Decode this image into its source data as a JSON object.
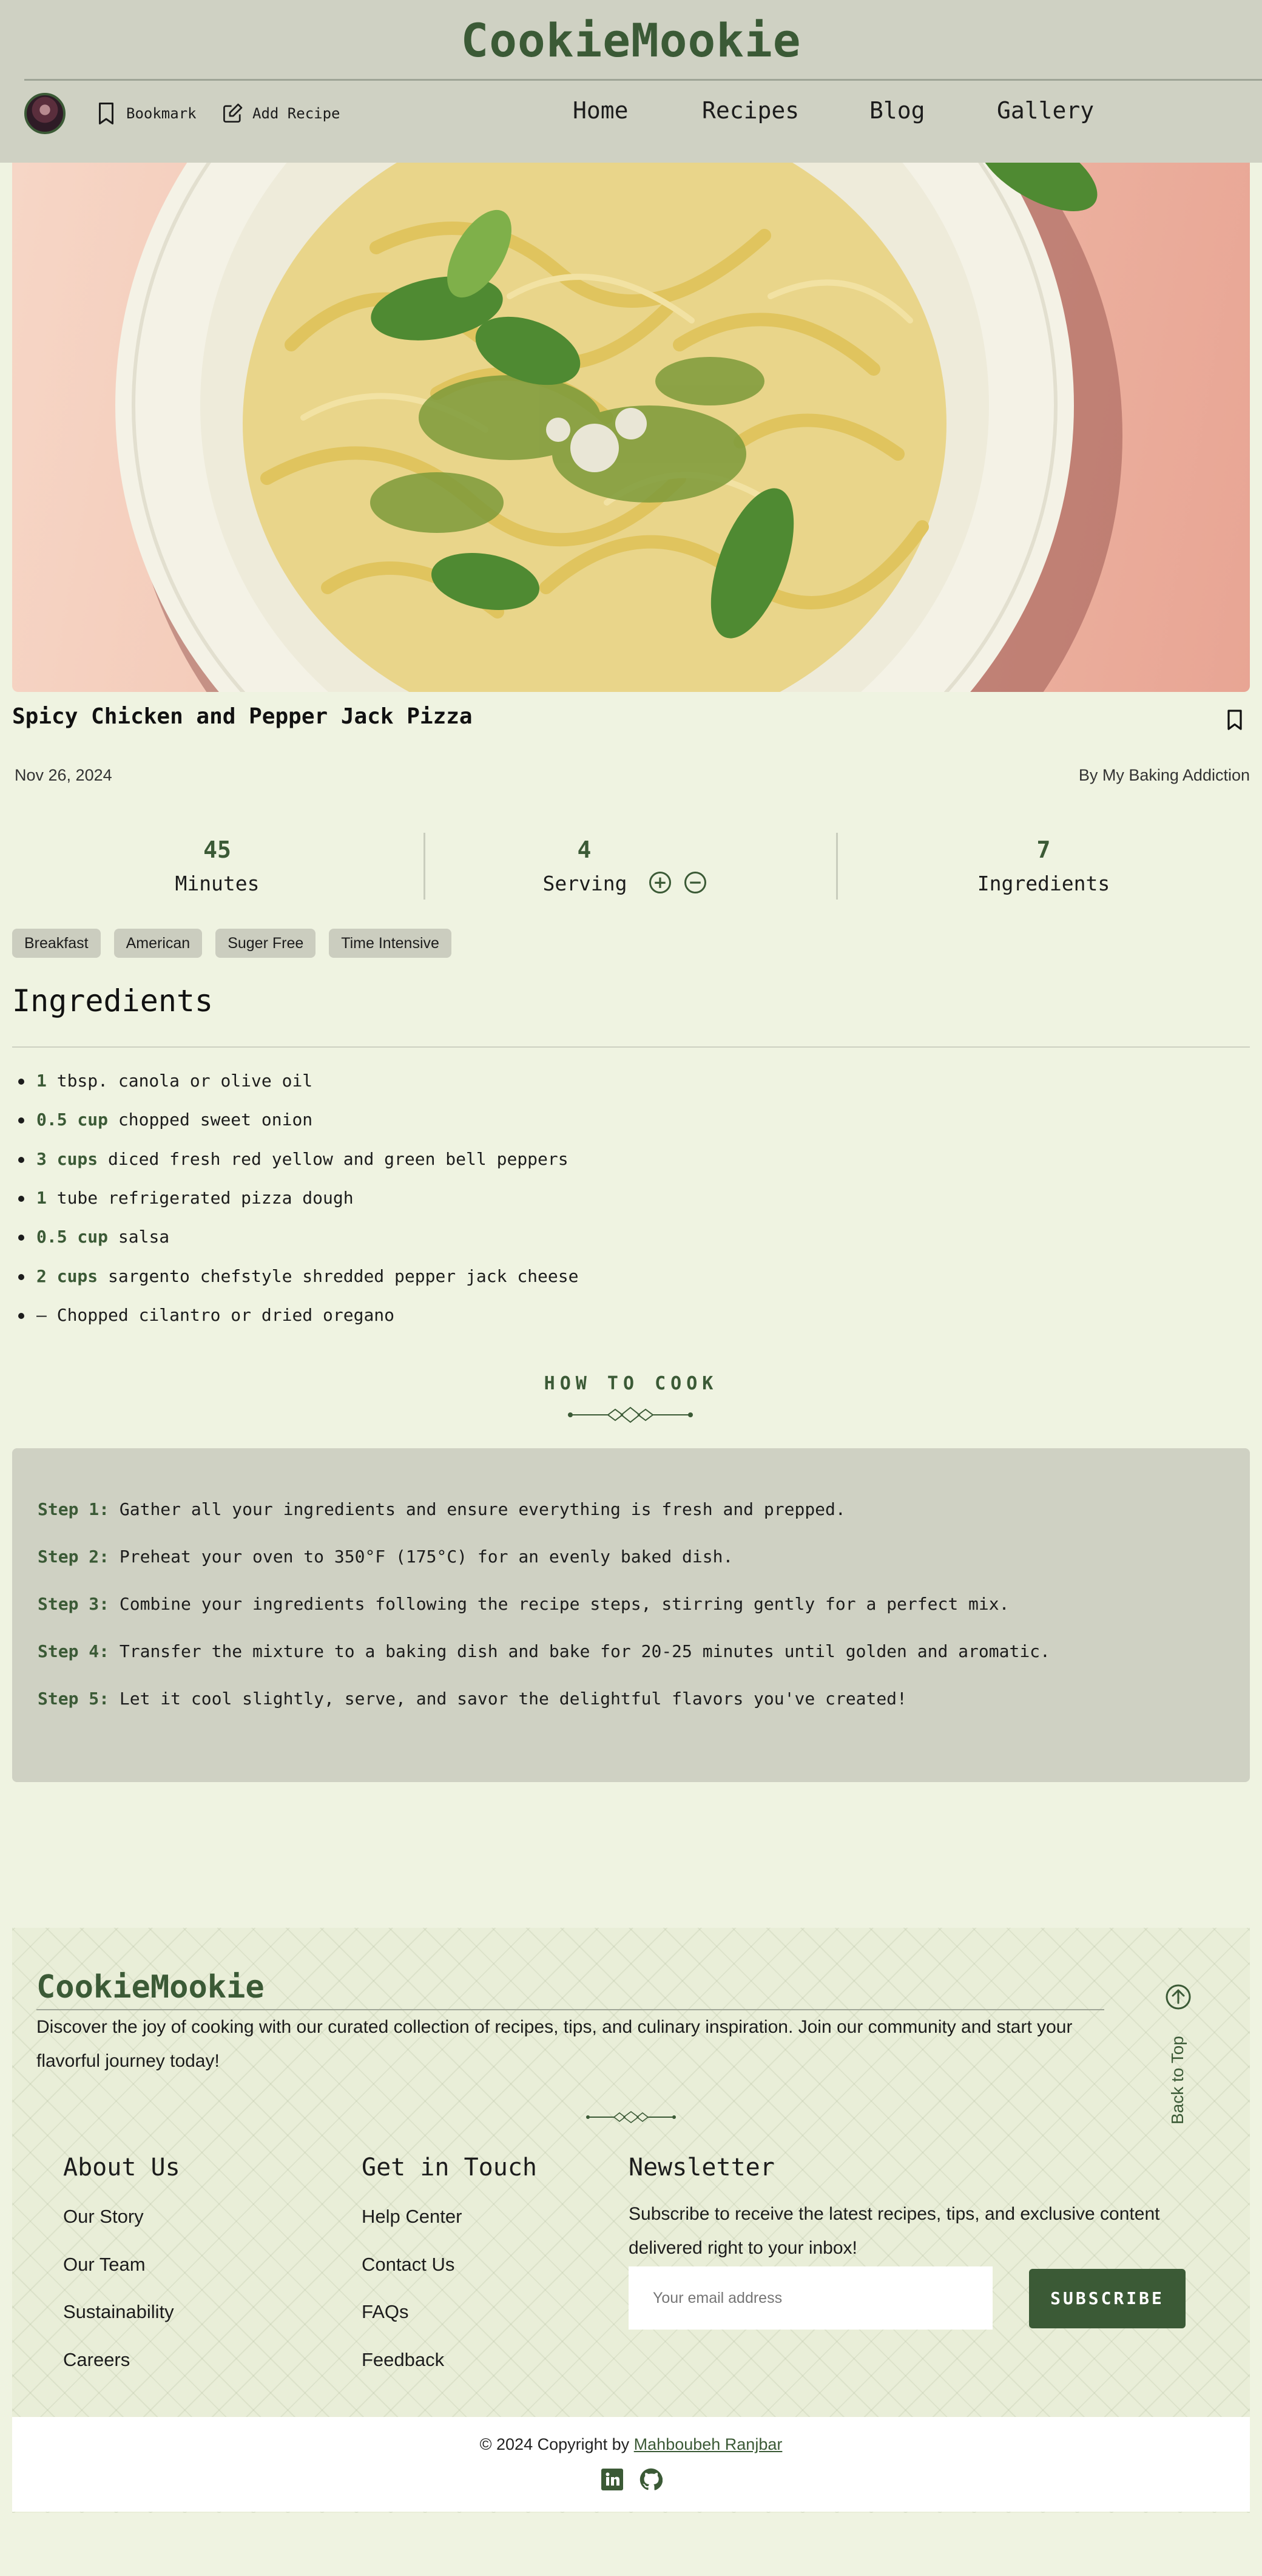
{
  "header": {
    "logo": "CookieMookie",
    "bookmark_label": "Bookmark",
    "add_recipe_label": "Add Recipe",
    "nav": [
      "Home",
      "Recipes",
      "Blog",
      "Gallery"
    ]
  },
  "recipe": {
    "title": "Spicy Chicken and Pepper Jack Pizza",
    "date": "Nov 26, 2024",
    "author": "By My Baking Addiction",
    "stats": {
      "minutes_value": "45",
      "minutes_label": "Minutes",
      "serving_value": "4",
      "serving_label": "Serving",
      "ingredients_value": "7",
      "ingredients_label": "Ingredients"
    },
    "tags": [
      "Breakfast",
      "American",
      "Suger Free",
      "Time Intensive"
    ]
  },
  "ingredients": {
    "heading": "Ingredients",
    "items": [
      {
        "qty": "1",
        "text": "tbsp. canola or olive oil"
      },
      {
        "qty": "0.5 cup",
        "text": "chopped sweet onion"
      },
      {
        "qty": "3 cups",
        "text": "diced fresh red yellow and green bell peppers"
      },
      {
        "qty": "1",
        "text": "tube refrigerated pizza dough"
      },
      {
        "qty": "0.5 cup",
        "text": "salsa"
      },
      {
        "qty": "2 cups",
        "text": "sargento chefstyle shredded pepper jack cheese"
      },
      {
        "qty": "—",
        "text": "Chopped cilantro or dried oregano"
      }
    ]
  },
  "how_to_cook": {
    "heading": "HOW TO COOK",
    "steps": [
      {
        "label": "Step 1:",
        "text": "Gather all your ingredients and ensure everything is fresh and prepped."
      },
      {
        "label": "Step 2:",
        "text": "Preheat your oven to 350°F (175°C) for an evenly baked dish."
      },
      {
        "label": "Step 3:",
        "text": "Combine your ingredients following the recipe steps, stirring gently for a perfect mix."
      },
      {
        "label": "Step 4:",
        "text": "Transfer the mixture to a baking dish and bake for 20-25 minutes until golden and aromatic."
      },
      {
        "label": "Step 5:",
        "text": "Let it cool slightly, serve, and savor the delightful flavors you've created!"
      }
    ]
  },
  "footer": {
    "logo": "CookieMookie",
    "description": "Discover the joy of cooking with our curated collection of recipes, tips, and culinary inspiration. Join our community and start your flavorful journey today!",
    "back_to_top": "Back to Top",
    "about": {
      "heading": "About Us",
      "links": [
        "Our Story",
        "Our Team",
        "Sustainability",
        "Careers"
      ]
    },
    "contact": {
      "heading": "Get in Touch",
      "links": [
        "Help Center",
        "Contact Us",
        "FAQs",
        "Feedback"
      ]
    },
    "newsletter": {
      "heading": "Newsletter",
      "text": "Subscribe to receive the latest recipes, tips, and exclusive content delivered right to your inbox!",
      "placeholder": "Your email address",
      "button": "SUBSCRIBE"
    },
    "copyright_prefix": "© 2024 Copyright by ",
    "copyright_author": "Mahboubeh Ranjbar"
  },
  "colors": {
    "background": "#eff3e1",
    "header": "#cfd1c3",
    "accent": "#3b5a36"
  },
  "icons": [
    "bookmark-icon",
    "edit-icon",
    "plus-circle-icon",
    "minus-circle-icon",
    "arrow-up-circle-icon",
    "linkedin-icon",
    "github-icon"
  ]
}
